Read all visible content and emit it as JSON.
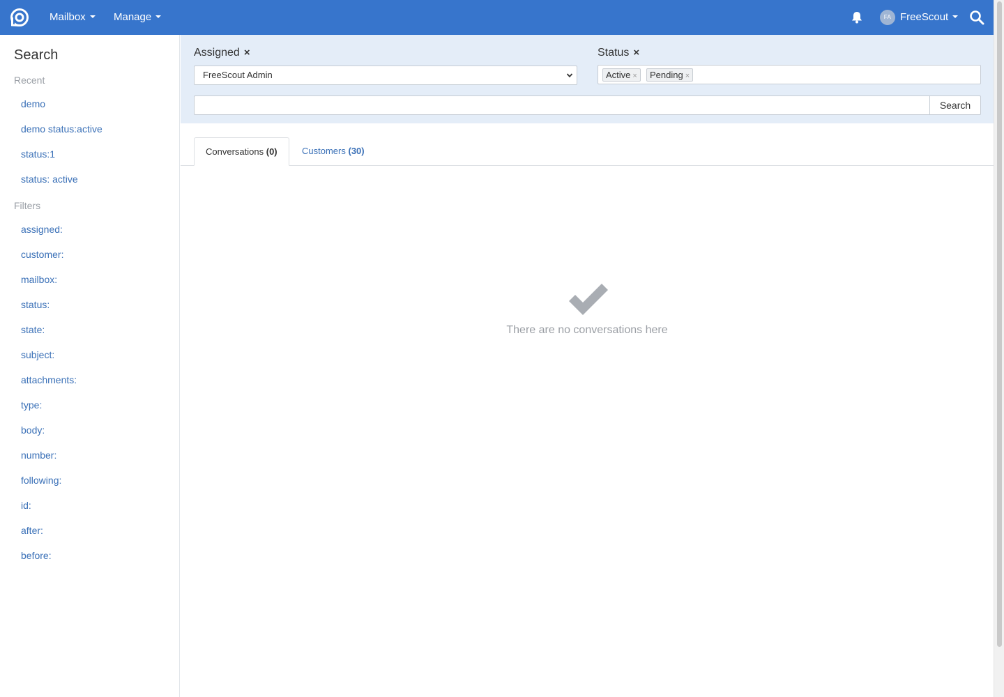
{
  "navbar": {
    "mailbox_label": "Mailbox",
    "manage_label": "Manage",
    "user_initials": "FA",
    "user_name": "FreeScout",
    "brand_color": "#3775cc"
  },
  "sidebar": {
    "title": "Search",
    "recent_heading": "Recent",
    "recent": [
      "demo",
      "demo status:active",
      "status:1",
      "status: active"
    ],
    "filters_heading": "Filters",
    "filters": [
      "assigned:",
      "customer:",
      "mailbox:",
      "status:",
      "state:",
      "subject:",
      "attachments:",
      "type:",
      "body:",
      "number:",
      "following:",
      "id:",
      "after:",
      "before:"
    ]
  },
  "filters": {
    "assigned_label": "Assigned",
    "assigned_value": "FreeScout Admin",
    "status_label": "Status",
    "status_tags": [
      "Active",
      "Pending"
    ],
    "remove_symbol": "×",
    "search_value": "",
    "search_button": "Search"
  },
  "tabs": {
    "conversations_label": "Conversations",
    "conversations_count": "(0)",
    "customers_label": "Customers",
    "customers_count": "(30)"
  },
  "empty_state": {
    "icon": "check-icon",
    "message": "There are no conversations here"
  }
}
